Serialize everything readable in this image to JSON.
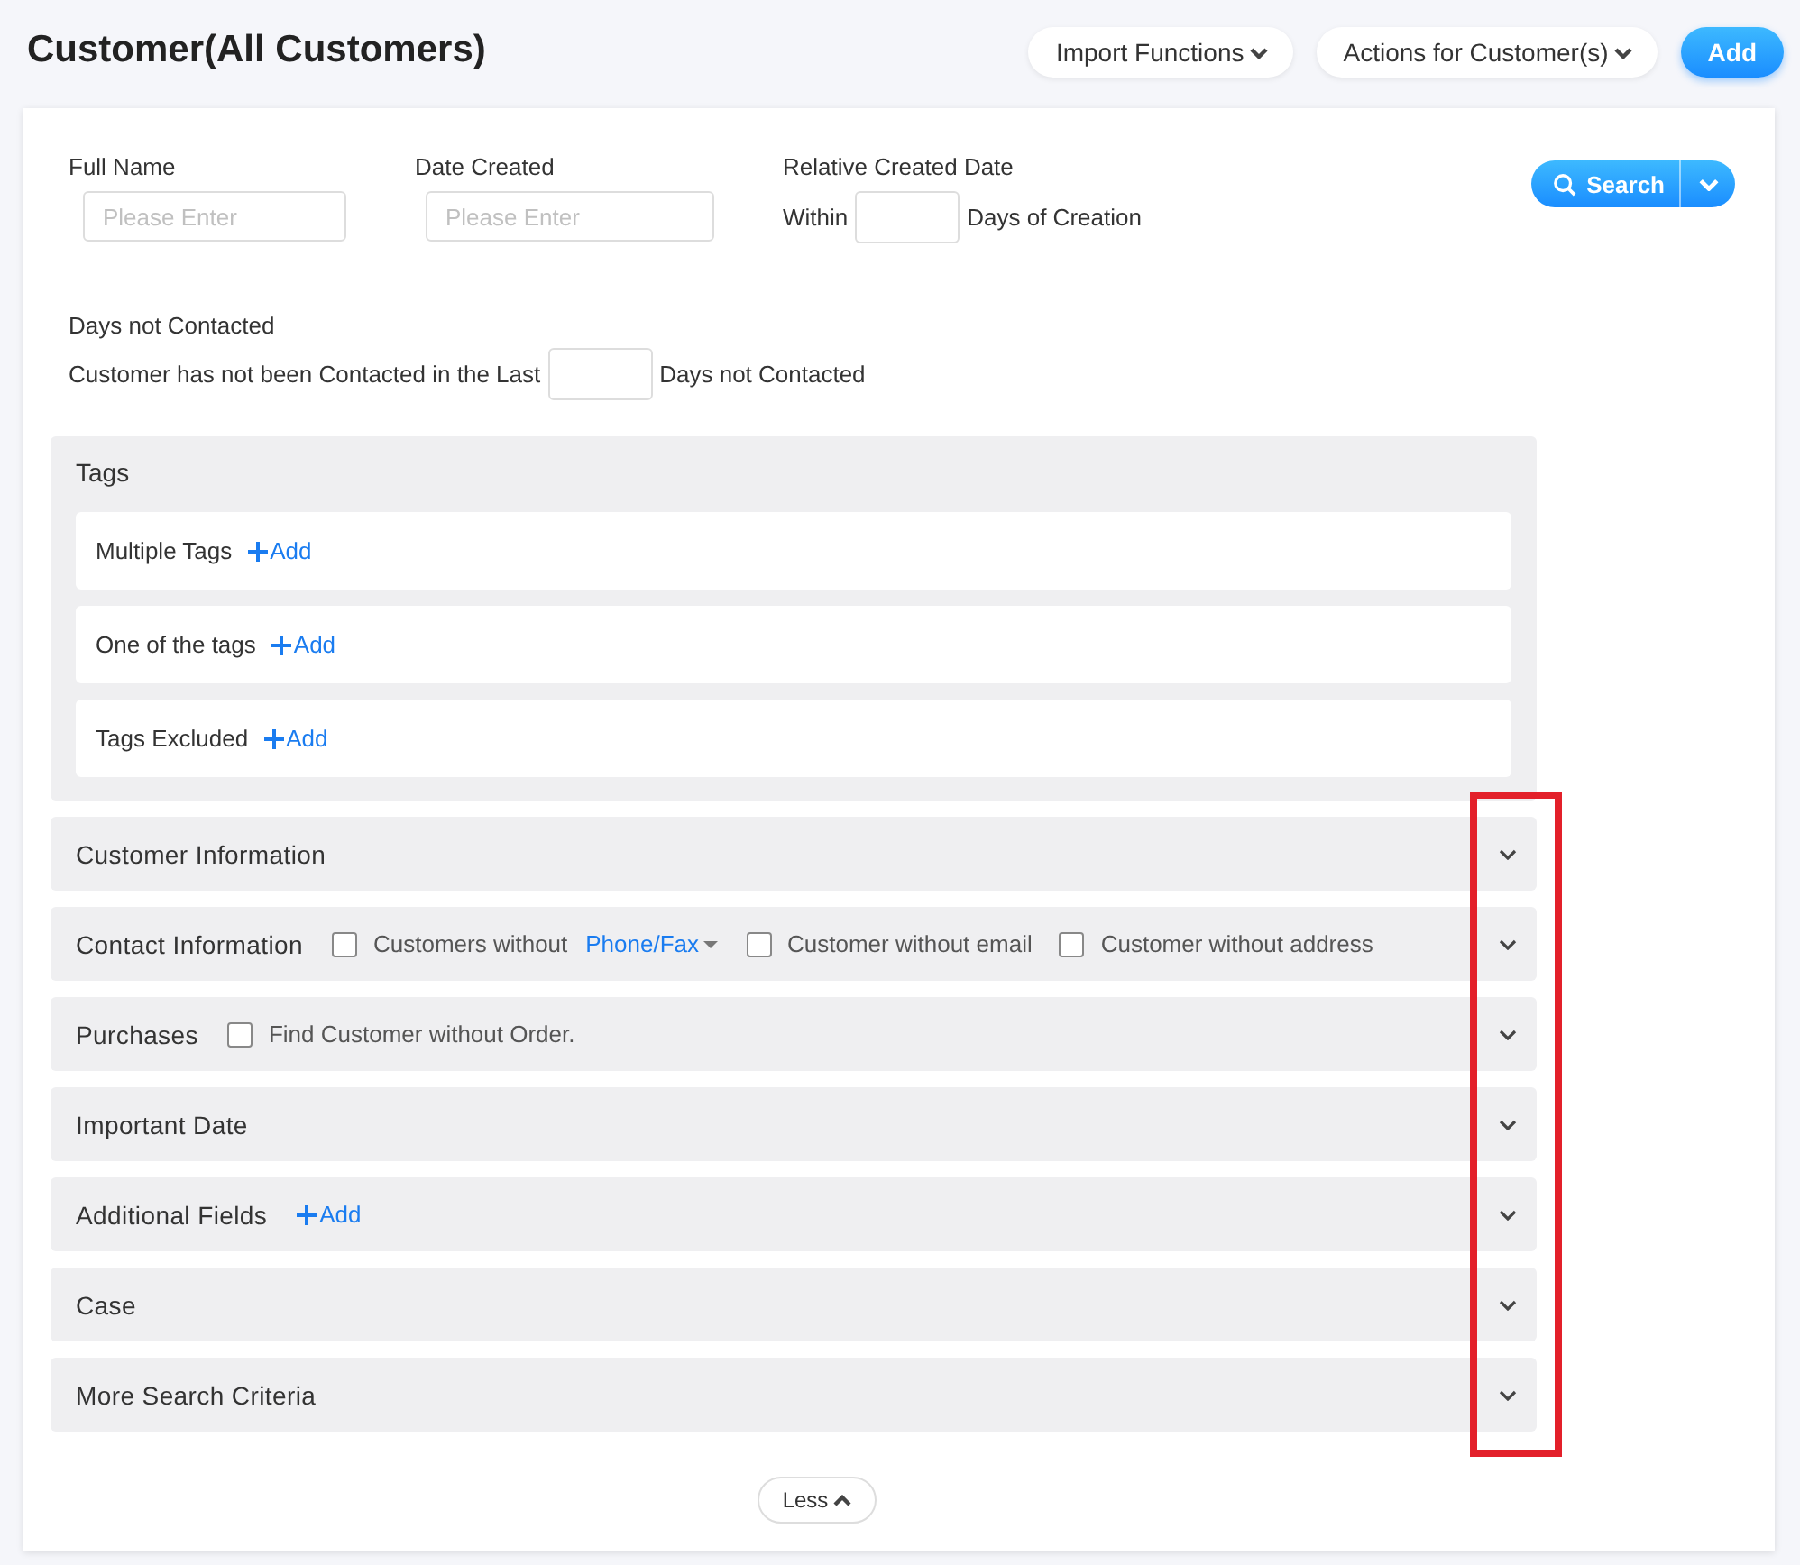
{
  "page": {
    "title": "Customer(All Customers)"
  },
  "header_actions": [
    {
      "kind": "menu",
      "label": "Import Functions"
    },
    {
      "kind": "menu",
      "label": "Actions for Customer(s)"
    },
    {
      "kind": "primary",
      "label": "Add"
    }
  ],
  "filters": [
    {
      "label": "Full Name",
      "kind": "text",
      "placeholder": "Please Enter"
    },
    {
      "label": "Date Created",
      "kind": "text",
      "placeholder": "Please Enter"
    },
    {
      "label": "Relative Created Date",
      "kind": "inline",
      "before": "Within",
      "after": "Days of Creation"
    }
  ],
  "search_button": {
    "label": "Search"
  },
  "days_not_contacted": {
    "label": "Days not Contacted",
    "before": "Customer has not been Contacted in the Last",
    "after": "Days not Contacted"
  },
  "tags": {
    "title": "Tags",
    "rows": [
      {
        "label": "Multiple Tags",
        "action": "Add"
      },
      {
        "label": "One of the tags",
        "action": "Add"
      },
      {
        "label": "Tags Excluded",
        "action": "Add"
      }
    ]
  },
  "sections": [
    {
      "title": "Customer Information",
      "expanded": false
    },
    {
      "title": "Contact Information",
      "expanded": false,
      "extras": [
        {
          "kind": "checkbox",
          "label": "Customers without",
          "checked": false
        },
        {
          "kind": "dropdown-link",
          "label": "Phone/Fax"
        },
        {
          "kind": "checkbox",
          "label": "Customer without email",
          "checked": false
        },
        {
          "kind": "checkbox",
          "label": "Customer without address",
          "checked": false
        }
      ]
    },
    {
      "title": "Purchases",
      "expanded": false,
      "extras": [
        {
          "kind": "checkbox",
          "label": "Find Customer without Order.",
          "checked": false
        }
      ]
    },
    {
      "title": "Important Date",
      "expanded": false
    },
    {
      "title": "Additional Fields",
      "expanded": false,
      "extras": [
        {
          "kind": "add",
          "label": "Add"
        }
      ]
    },
    {
      "title": "Case",
      "expanded": false
    },
    {
      "title": "More Search Criteria",
      "expanded": false
    }
  ],
  "toggle_button": {
    "label": "Less",
    "expanded": true
  },
  "annotation": {
    "kind": "rectangle",
    "color": "#e3202a"
  }
}
